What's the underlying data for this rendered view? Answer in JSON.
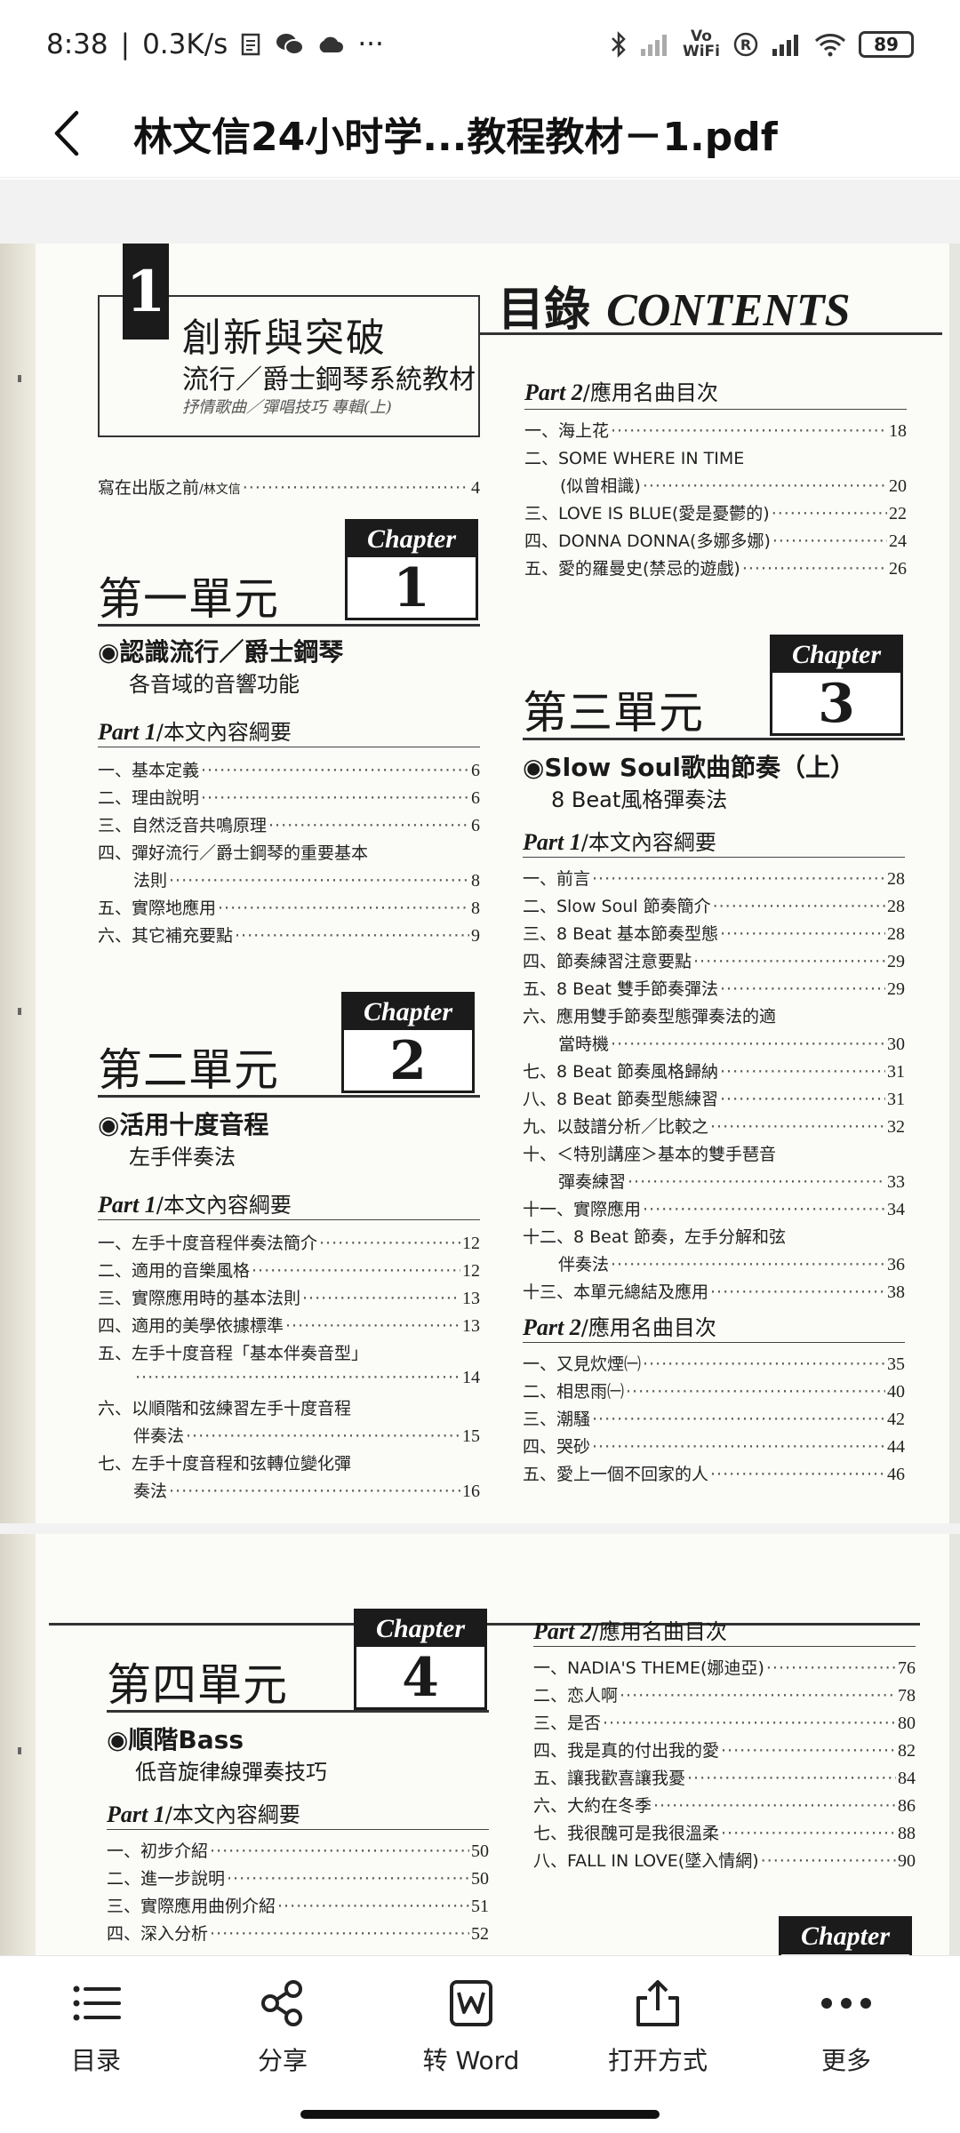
{
  "status_bar": {
    "time": "8:38",
    "net_speed": "0.3K/s",
    "more": "···",
    "vowifi": "Vo\nWiFi",
    "battery": "89"
  },
  "header": {
    "title": "林文信24小时学...教程教材－1.pdf"
  },
  "pdf": {
    "cover": {
      "number": "1",
      "title": "創新與突破",
      "subtitle": "流行／爵士鋼琴系統教材",
      "subtitle2": "抒情歌曲／彈唱技巧 專輯(上)"
    },
    "contents_title": {
      "cn": "目錄",
      "en": "CONTENTS"
    },
    "preface": {
      "text": "寫在出版之前",
      "author": "/林文信",
      "page": "4"
    },
    "chapter_label": "Chapter",
    "units": [
      {
        "title": "第一單元",
        "chapter": "1",
        "topic": "◉認識流行／爵士鋼琴",
        "topic_sub": "各音域的音響功能",
        "part": "Part 1",
        "part_text": "/本文內容綱要",
        "items": [
          {
            "t": "一、基本定義",
            "p": "6"
          },
          {
            "t": "二、理由說明",
            "p": "6"
          },
          {
            "t": "三、自然泛音共鳴原理",
            "p": "6"
          },
          {
            "t": "四、彈好流行／爵士鋼琴的重要基本",
            "p": ""
          },
          {
            "t": "法則",
            "p": "8",
            "cont": true
          },
          {
            "t": "五、實際地應用",
            "p": "8"
          },
          {
            "t": "六、其它補充要點",
            "p": "9"
          }
        ]
      },
      {
        "title": "第二單元",
        "chapter": "2",
        "topic": "◉活用十度音程",
        "topic_sub": "左手伴奏法",
        "part": "Part 1",
        "part_text": "/本文內容綱要",
        "items": [
          {
            "t": "一、左手十度音程伴奏法簡介",
            "p": "12"
          },
          {
            "t": "二、適用的音樂風格",
            "p": "12"
          },
          {
            "t": "三、實際應用時的基本法則",
            "p": "13"
          },
          {
            "t": "四、適用的美學依據標準",
            "p": "13"
          },
          {
            "t": "五、左手十度音程「基本伴奏音型」",
            "p": ""
          },
          {
            "t": "",
            "p": "14",
            "cont": true
          },
          {
            "t": "六、以順階和弦練習左手十度音程",
            "p": ""
          },
          {
            "t": "伴奏法",
            "p": "15",
            "cont": true
          },
          {
            "t": "七、左手十度音程和弦轉位變化彈",
            "p": ""
          },
          {
            "t": "奏法",
            "p": "16",
            "cont": true
          }
        ]
      },
      {
        "title": "第三單元",
        "chapter": "3",
        "topic": "◉Slow Soul歌曲節奏（上）",
        "topic_sub": "8 Beat風格彈奏法",
        "part": "Part 1",
        "part_text": "/本文內容綱要",
        "items": [
          {
            "t": "一、前言",
            "p": "28"
          },
          {
            "t": "二、Slow Soul 節奏簡介",
            "p": "28"
          },
          {
            "t": "三、8 Beat 基本節奏型態",
            "p": "28"
          },
          {
            "t": "四、節奏練習注意要點",
            "p": "29"
          },
          {
            "t": "五、8 Beat 雙手節奏彈法",
            "p": "29"
          },
          {
            "t": "六、應用雙手節奏型態彈奏法的適",
            "p": ""
          },
          {
            "t": "當時機",
            "p": "30",
            "cont": true
          },
          {
            "t": "七、8 Beat 節奏風格歸納",
            "p": "31"
          },
          {
            "t": "八、8 Beat 節奏型態練習",
            "p": "31"
          },
          {
            "t": "九、以鼓譜分析／比較之",
            "p": "32"
          },
          {
            "t": "十、＜特別講座＞基本的雙手琶音",
            "p": ""
          },
          {
            "t": "彈奏練習",
            "p": "33",
            "cont": true
          },
          {
            "t": "十一、實際應用",
            "p": "34"
          },
          {
            "t": "十二、8 Beat 節奏，左手分解和弦",
            "p": ""
          },
          {
            "t": "伴奏法",
            "p": "36",
            "cont": true
          },
          {
            "t": "十三、本單元總結及應用",
            "p": "38"
          }
        ],
        "part2": "Part 2",
        "part2_text": "/應用名曲目次",
        "songs": [
          {
            "t": "一、又見炊煙㈠",
            "p": "35"
          },
          {
            "t": "二、相思雨㈠",
            "p": "40"
          },
          {
            "t": "三、潮騷",
            "p": "42"
          },
          {
            "t": "四、哭砂",
            "p": "44"
          },
          {
            "t": "五、愛上一個不回家的人",
            "p": "46"
          }
        ]
      },
      {
        "title": "第四單元",
        "chapter": "4",
        "topic": "◉順階Bass",
        "topic_sub": "低音旋律線彈奏技巧",
        "part": "Part 1",
        "part_text": "/本文內容綱要",
        "items": [
          {
            "t": "一、初步介紹",
            "p": "50"
          },
          {
            "t": "二、進一步說明",
            "p": "50"
          },
          {
            "t": "三、實際應用曲例介紹",
            "p": "51"
          },
          {
            "t": "四、深入分析",
            "p": "52"
          }
        ],
        "part2": "Part 2",
        "part2_text": "/應用名曲目次",
        "songs": [
          {
            "t": "一、NADIA'S THEME(娜迪亞)",
            "p": "76"
          },
          {
            "t": "二、恋人啊",
            "p": "78"
          },
          {
            "t": "三、是否",
            "p": "80"
          },
          {
            "t": "四、我是真的付出我的愛",
            "p": "82"
          },
          {
            "t": "五、讓我歡喜讓我憂",
            "p": "84"
          },
          {
            "t": "六、大約在冬季",
            "p": "86"
          },
          {
            "t": "七、我很醜可是我很溫柔",
            "p": "88"
          },
          {
            "t": "八、FALL IN LOVE(墜入情網)",
            "p": "90"
          }
        ]
      }
    ],
    "unit2_songs": {
      "part": "Part 2",
      "part_text": "/應用名曲目次",
      "items": [
        {
          "t": "一、海上花",
          "p": "18"
        },
        {
          "t": "二、SOME WHERE IN TIME",
          "p": ""
        },
        {
          "t": "(似曾相識)",
          "p": "20",
          "cont": true
        },
        {
          "t": "三、LOVE IS BLUE(愛是憂鬱的)",
          "p": "22"
        },
        {
          "t": "四、DONNA DONNA(多娜多娜)",
          "p": "24"
        },
        {
          "t": "五、愛的羅曼史(禁忌的遊戲)",
          "p": "26"
        }
      ]
    }
  },
  "bottom_bar": {
    "tabs": [
      {
        "label": "目录",
        "icon": "list-icon"
      },
      {
        "label": "分享",
        "icon": "share-icon"
      },
      {
        "label": "转 Word",
        "icon": "word-icon"
      },
      {
        "label": "打开方式",
        "icon": "open-with-icon"
      },
      {
        "label": "更多",
        "icon": "more-icon"
      }
    ]
  }
}
